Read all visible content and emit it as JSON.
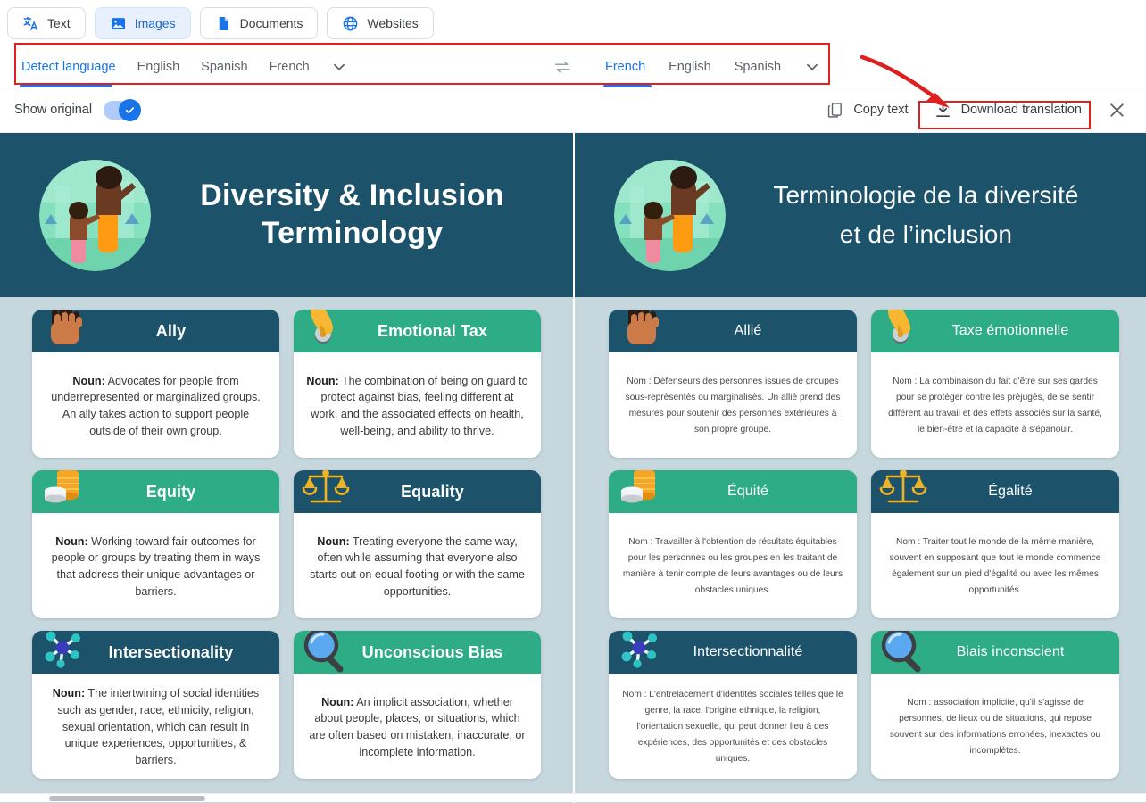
{
  "tabs": [
    {
      "label": "Text",
      "icon": "translate-icon",
      "active": false
    },
    {
      "label": "Images",
      "icon": "image-icon",
      "active": true
    },
    {
      "label": "Documents",
      "icon": "document-icon",
      "active": false
    },
    {
      "label": "Websites",
      "icon": "globe-icon",
      "active": false
    }
  ],
  "source_languages": {
    "options": [
      "Detect language",
      "English",
      "Spanish",
      "French"
    ],
    "selected": "Detect language",
    "more_icon": "chevron-down-icon"
  },
  "swap_icon": "swap-languages-icon",
  "target_languages": {
    "options": [
      "French",
      "English",
      "Spanish"
    ],
    "selected": "French",
    "more_icon": "chevron-down-icon"
  },
  "actionbar": {
    "show_original_label": "Show original",
    "show_original_on": true,
    "copy_text_label": "Copy text",
    "copy_icon": "copy-icon",
    "download_label": "Download translation",
    "download_icon": "download-icon",
    "close_icon": "close-icon"
  },
  "colors": {
    "accent": "#1a73e8",
    "annotation": "#e02020",
    "navy": "#1c536b",
    "teal": "#2eac86",
    "page_bg": "#c6d7dd"
  },
  "original": {
    "hero_title_line1": "Diversity & Inclusion",
    "hero_title_line2": "Terminology",
    "hero_image": "illustration-adult-and-child",
    "cards": [
      {
        "title": "Ally",
        "icon": "raised-fist-icon",
        "head_color": "navy",
        "label": "Noun:",
        "definition": " Advocates for people from underrepresented or marginalized groups. An ally takes action to support people outside of their own group."
      },
      {
        "title": "Emotional Tax",
        "icon": "hand-coin-icon",
        "head_color": "teal",
        "label": "Noun:",
        "definition": " The combination of being on guard to protect against bias, feeling different at work, and the associated effects on health, well-being, and ability to thrive."
      },
      {
        "title": "Equity",
        "icon": "coins-stack-icon",
        "head_color": "teal",
        "label": "Noun:",
        "definition": " Working toward fair outcomes for people or groups by treating them in ways that address their unique advantages or barriers."
      },
      {
        "title": "Equality",
        "icon": "balance-scale-icon",
        "head_color": "navy",
        "label": "Noun:",
        "definition": " Treating everyone the same way, often while assuming that everyone also starts out on equal footing or with the same opportunities."
      },
      {
        "title": "Intersectionality",
        "icon": "network-nodes-icon",
        "head_color": "navy",
        "label": "Noun:",
        "definition": " The intertwining of social identities such as gender, race, ethnicity, religion, sexual orientation, which can result in unique experiences, opportunities, & barriers."
      },
      {
        "title": "Unconscious Bias",
        "icon": "magnifying-glass-icon",
        "head_color": "teal",
        "label": "Noun:",
        "definition": " An implicit association, whether about people, places, or situations, which are often based on mistaken, inaccurate, or incomplete information."
      }
    ]
  },
  "translated": {
    "hero_title_line1": "Terminologie de la diversité",
    "hero_title_line2": "et de l’inclusion",
    "hero_image": "illustration-adult-and-child",
    "cards": [
      {
        "title": "Allié",
        "icon": "raised-fist-icon",
        "head_color": "navy",
        "label": "Nom :",
        "definition": " Défenseurs des personnes issues de groupes sous-représentés ou marginalisés. Un allié prend des mesures pour soutenir des personnes extérieures à son propre groupe."
      },
      {
        "title": "Taxe émotionnelle",
        "icon": "hand-coin-icon",
        "head_color": "teal",
        "label": "Nom :",
        "definition": " La combinaison du fait d'être sur ses gardes pour se protéger contre les préjugés, de se sentir différent au travail et des effets associés sur la santé, le bien-être et la capacité à s'épanouir."
      },
      {
        "title": "Équité",
        "icon": "coins-stack-icon",
        "head_color": "teal",
        "label": "Nom :",
        "definition": " Travailler à l'obtention de résultats équitables pour les personnes ou les groupes en les traitant de manière à tenir compte de leurs avantages ou de leurs obstacles uniques."
      },
      {
        "title": "Égalité",
        "icon": "balance-scale-icon",
        "head_color": "navy",
        "label": "Nom :",
        "definition": " Traiter tout le monde de la même manière, souvent en supposant que tout le monde commence également sur un pied d'égalité ou avec les mêmes opportunités."
      },
      {
        "title": "Intersectionnalité",
        "icon": "network-nodes-icon",
        "head_color": "navy",
        "label": "Nom :",
        "definition": " L'entrelacement d'identités sociales telles que le genre, la race, l'origine ethnique, la religion, l'orientation sexuelle, qui peut donner lieu à des expériences, des opportunités et des obstacles uniques."
      },
      {
        "title": "Biais inconscient",
        "icon": "magnifying-glass-icon",
        "head_color": "teal",
        "label": "Nom :",
        "definition": " association implicite, qu'il s'agisse de personnes, de lieux ou de situations, qui repose souvent sur des informations erronées, inexactes ou incomplètes."
      }
    ]
  }
}
